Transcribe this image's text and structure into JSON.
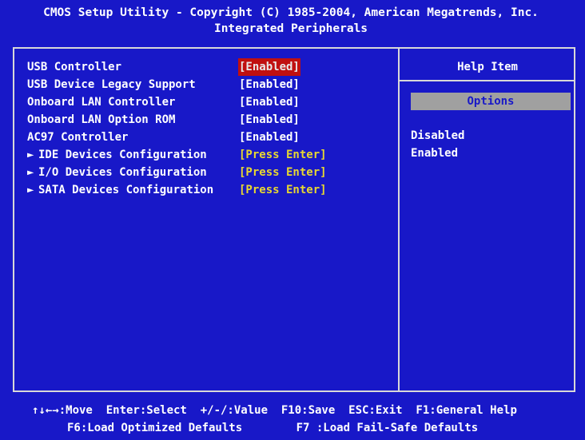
{
  "header": {
    "line1": "CMOS Setup Utility - Copyright (C) 1985-2004, American Megatrends, Inc.",
    "line2": "Integrated Peripherals"
  },
  "settings": [
    {
      "label": "USB Controller",
      "value": "[Enabled]",
      "selected": true,
      "submenu": false
    },
    {
      "label": "USB Device Legacy Support",
      "value": "[Enabled]",
      "selected": false,
      "submenu": false
    },
    {
      "label": "Onboard LAN Controller",
      "value": "[Enabled]",
      "selected": false,
      "submenu": false
    },
    {
      "label": "Onboard LAN Option ROM",
      "value": "[Enabled]",
      "selected": false,
      "submenu": false
    },
    {
      "label": "AC97 Controller",
      "value": "[Enabled]",
      "selected": false,
      "submenu": false
    },
    {
      "label": "IDE Devices Configuration",
      "value": "[Press Enter]",
      "selected": false,
      "submenu": true,
      "arrow": "►"
    },
    {
      "label": "I/O Devices Configuration",
      "value": "[Press Enter]",
      "selected": false,
      "submenu": true,
      "arrow": "►"
    },
    {
      "label": "SATA Devices Configuration",
      "value": "[Press Enter]",
      "selected": false,
      "submenu": true,
      "arrow": "►"
    }
  ],
  "help": {
    "title": "Help Item",
    "options_label": "Options",
    "options": [
      "Disabled",
      "Enabled"
    ]
  },
  "footer": {
    "line1": "↑↓←→:Move  Enter:Select  +/-/:Value  F10:Save  ESC:Exit  F1:General Help",
    "line2": "F6:Load Optimized Defaults        F7 :Load Fail-Safe Defaults"
  },
  "colors": {
    "background": "#1818c8",
    "selected_bg": "#c01010",
    "submenu_value": "#e8d830",
    "options_bar": "#a0a0a0"
  }
}
